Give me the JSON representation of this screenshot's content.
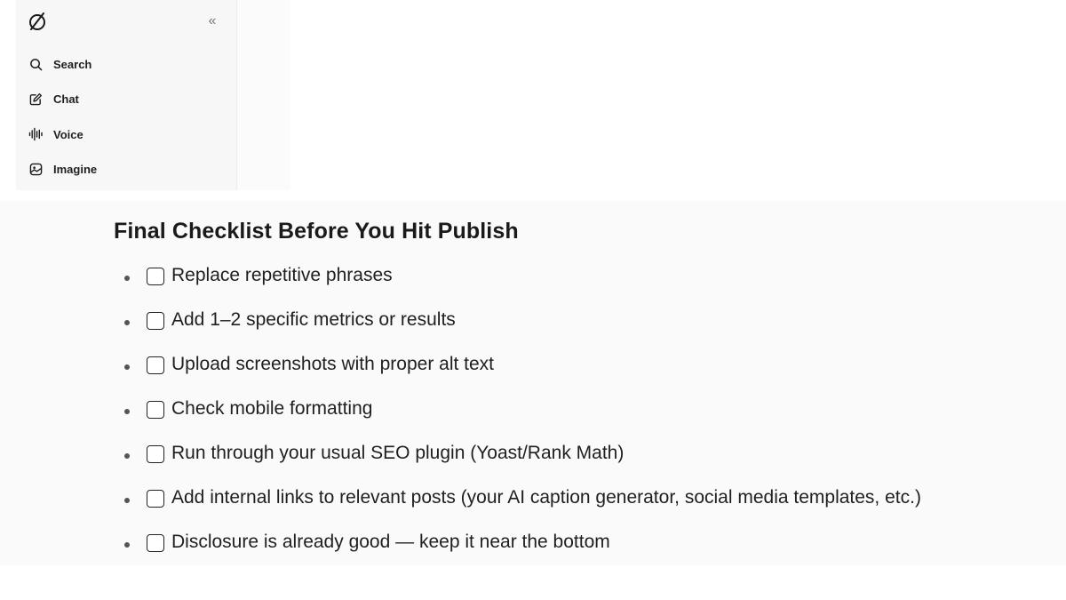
{
  "sidebar": {
    "logo_icon": "grok-logo-icon",
    "collapse_icon": "double-chevron-left-icon",
    "collapse_glyph": "«",
    "items": [
      {
        "label": "Search",
        "icon": "search-icon"
      },
      {
        "label": "Chat",
        "icon": "edit-chat-icon"
      },
      {
        "label": "Voice",
        "icon": "waveform-icon"
      },
      {
        "label": "Imagine",
        "icon": "image-icon"
      }
    ]
  },
  "content": {
    "heading": "Final Checklist Before You Hit Publish",
    "checklist": [
      {
        "text": "Replace repetitive phrases",
        "checked": false
      },
      {
        "text": "Add 1–2 specific metrics or results",
        "checked": false
      },
      {
        "text": "Upload screenshots with proper alt text",
        "checked": false
      },
      {
        "text": "Check mobile formatting",
        "checked": false
      },
      {
        "text": "Run through your usual SEO plugin (Yoast/Rank Math)",
        "checked": false
      },
      {
        "text": "Add internal links to relevant posts (your AI caption generator, social media templates, etc.)",
        "checked": false
      },
      {
        "text": "Disclosure is already good — keep it near the bottom",
        "checked": false
      }
    ]
  },
  "colors": {
    "sidebar_bg": "#f7f7f7",
    "content_bg": "#fafafa",
    "text": "#1a1a1a"
  }
}
